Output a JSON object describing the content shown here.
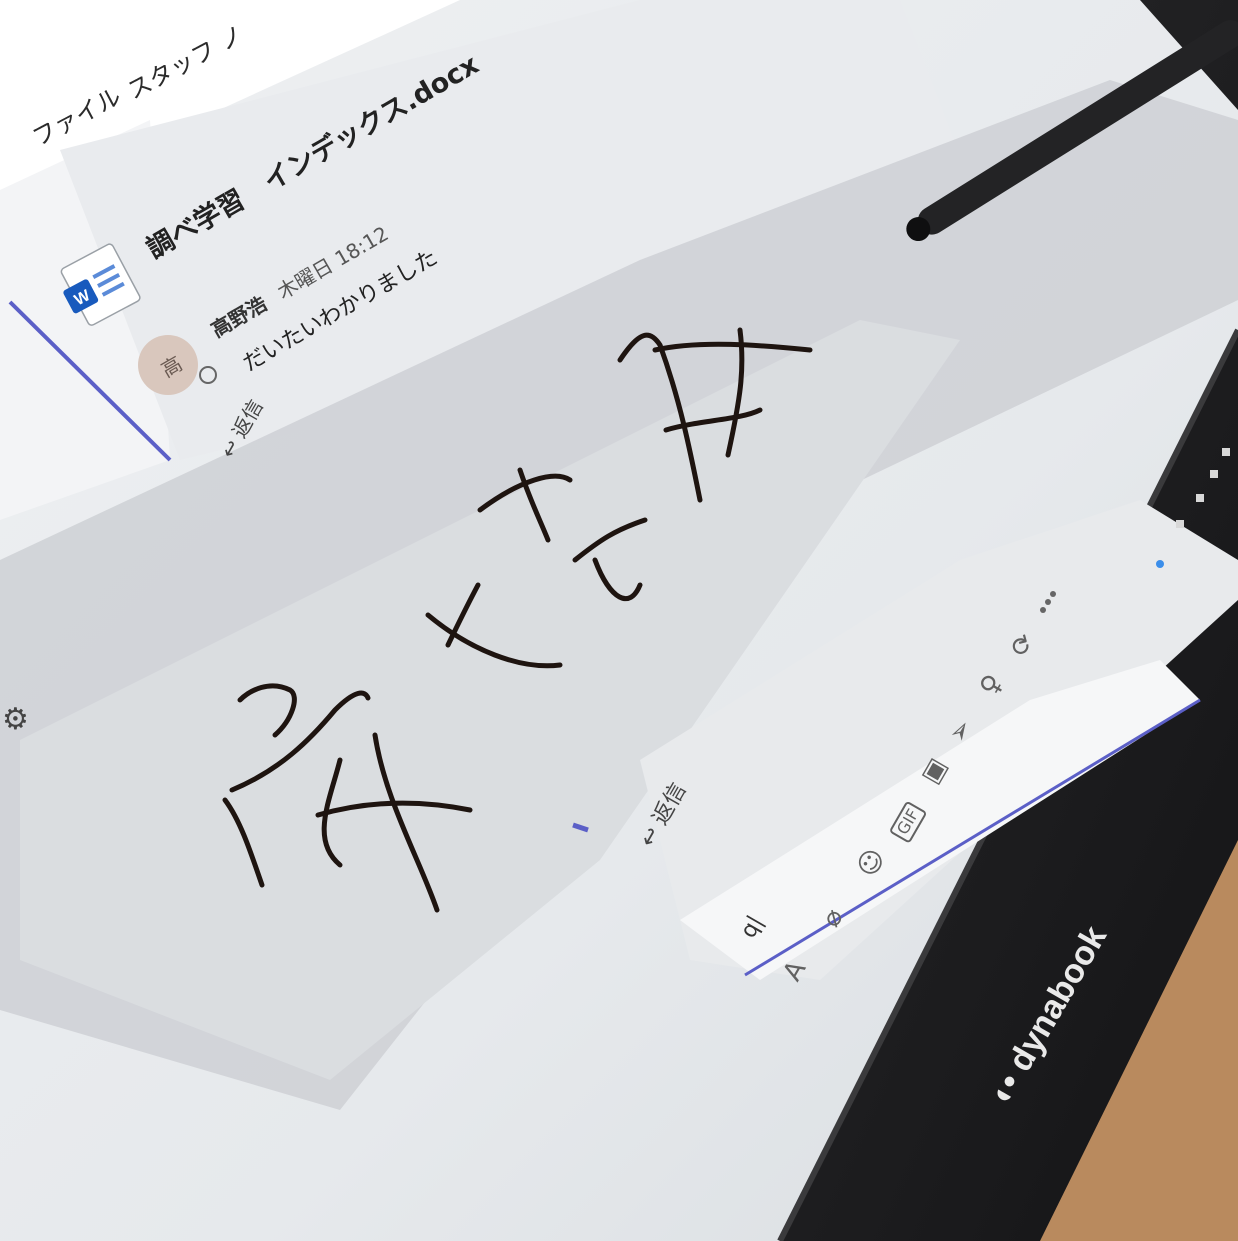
{
  "tabs": {
    "files": "ファイル",
    "staff": "スタッフ ノ"
  },
  "post": {
    "title": "調べ学習　インデックス.docx",
    "file_icon": "word-file-icon",
    "author": "高野浩",
    "timestamp": "木曜日 18:12",
    "message": "だいたいわかりました",
    "avatar_initial": "高",
    "reply_label": "返信"
  },
  "ink": {
    "strokes_description": "handwritten ink strokes"
  },
  "reply_box": {
    "reply_label": "返信"
  },
  "compose": {
    "text": "q|",
    "toolbar_icons": [
      "format-icon",
      "attach-icon",
      "emoji-icon",
      "gif-icon",
      "sticker-icon",
      "send-later-icon",
      "praise-icon",
      "loop-icon",
      "more-icon"
    ],
    "more_label": "..."
  },
  "bezel": {
    "brand": "dynabook"
  },
  "colors": {
    "accent": "#5b5fc7",
    "ink": "#1e1410",
    "bezel": "#1b1a1c",
    "wood": "#b98a5e"
  }
}
